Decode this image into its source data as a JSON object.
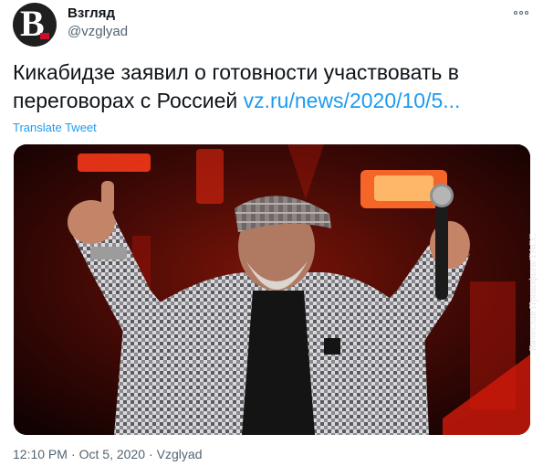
{
  "account": {
    "display_name": "Взгляд",
    "handle": "@vzglyad",
    "avatar_letter": "B"
  },
  "tweet": {
    "text": "Кикабидзе заявил о готовности участвовать в переговорах с Россией ",
    "link": "vz.ru/news/2020/10/5...",
    "translate_label": "Translate Tweet"
  },
  "photo": {
    "credit": "Вячеслав Прокофьев/ТАСС"
  },
  "meta": {
    "time": "12:10 PM",
    "separator": "·",
    "date": "Oct 5, 2020",
    "source": "Vzglyad"
  },
  "icons": {
    "more": "more-horizontal-icon"
  },
  "colors": {
    "link": "#1d9bf0",
    "secondary_text": "#536471",
    "primary_text": "#0f1419"
  }
}
